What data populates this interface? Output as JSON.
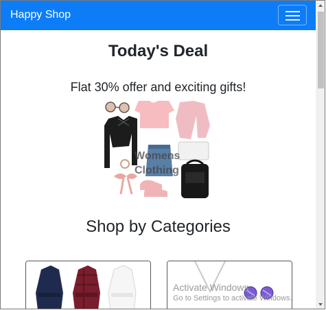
{
  "navbar": {
    "brand": "Happy Shop"
  },
  "main": {
    "deal_heading": "Today's Deal",
    "offer_text": "Flat 30% offer and exciting gifts!",
    "image_overlay": [
      "Womens",
      "Clothing"
    ],
    "categories_heading": "Shop by Categories"
  },
  "watermark": {
    "line1": "Activate Windows",
    "line2": "Go to Settings to activate Windows."
  },
  "colors": {
    "navbar": "#0d7df7",
    "text": "#212529"
  }
}
